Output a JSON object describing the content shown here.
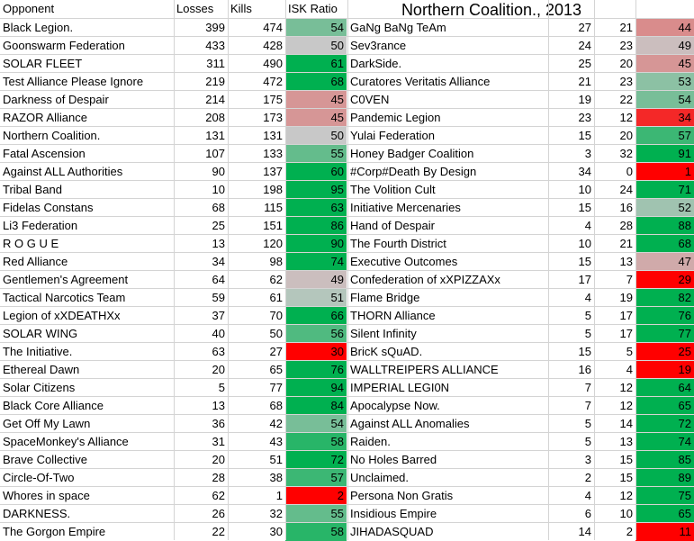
{
  "chart_data": {
    "type": "table",
    "title": "Northern Coalition., 2013",
    "columns": [
      "Opponent",
      "Losses",
      "Kills",
      "ISK Ratio"
    ],
    "left_rows": [
      [
        "Black Legion.",
        399,
        474,
        54
      ],
      [
        "Goonswarm Federation",
        433,
        428,
        50
      ],
      [
        "SOLAR FLEET",
        311,
        490,
        61
      ],
      [
        "Test Alliance Please Ignore",
        219,
        472,
        68
      ],
      [
        "Darkness of Despair",
        214,
        175,
        45
      ],
      [
        "RAZOR Alliance",
        208,
        173,
        45
      ],
      [
        "Northern Coalition.",
        131,
        131,
        50
      ],
      [
        "Fatal Ascension",
        107,
        133,
        55
      ],
      [
        "Against ALL Authorities",
        90,
        137,
        60
      ],
      [
        "Tribal Band",
        10,
        198,
        95
      ],
      [
        "Fidelas Constans",
        68,
        115,
        63
      ],
      [
        "Li3 Federation",
        25,
        151,
        86
      ],
      [
        "R O G U E",
        13,
        120,
        90
      ],
      [
        "Red Alliance",
        34,
        98,
        74
      ],
      [
        "Gentlemen's Agreement",
        64,
        62,
        49
      ],
      [
        "Tactical Narcotics Team",
        59,
        61,
        51
      ],
      [
        "Legion of xXDEATHXx",
        37,
        70,
        66
      ],
      [
        "SOLAR WING",
        40,
        50,
        56
      ],
      [
        "The Initiative.",
        63,
        27,
        30
      ],
      [
        "Ethereal Dawn",
        20,
        65,
        76
      ],
      [
        "Solar Citizens",
        5,
        77,
        94
      ],
      [
        "Black Core Alliance",
        13,
        68,
        84
      ],
      [
        "Get Off My Lawn",
        36,
        42,
        54
      ],
      [
        "SpaceMonkey's Alliance",
        31,
        43,
        58
      ],
      [
        "Brave Collective",
        20,
        51,
        72
      ],
      [
        "Circle-Of-Two",
        28,
        38,
        57
      ],
      [
        "Whores in space",
        62,
        1,
        2
      ],
      [
        "DARKNESS.",
        26,
        32,
        55
      ],
      [
        "The Gorgon Empire",
        22,
        30,
        58
      ]
    ],
    "right_rows": [
      [
        "GaNg BaNg TeAm",
        27,
        21,
        44
      ],
      [
        "Sev3rance",
        24,
        23,
        49
      ],
      [
        "DarkSide.",
        25,
        20,
        45
      ],
      [
        "Curatores Veritatis Alliance",
        21,
        23,
        53
      ],
      [
        "C0VEN",
        19,
        22,
        54
      ],
      [
        "Pandemic Legion",
        23,
        12,
        34
      ],
      [
        "Yulai Federation",
        15,
        20,
        57
      ],
      [
        "Honey Badger Coalition",
        3,
        32,
        91
      ],
      [
        "#Corp#Death By Design",
        34,
        0,
        1
      ],
      [
        "The Volition Cult",
        10,
        24,
        71
      ],
      [
        "Initiative Mercenaries",
        15,
        16,
        52
      ],
      [
        "Hand of Despair",
        4,
        28,
        88
      ],
      [
        "The Fourth District",
        10,
        21,
        68
      ],
      [
        "Executive Outcomes",
        15,
        13,
        47
      ],
      [
        "Confederation of xXPIZZAXx",
        17,
        7,
        29
      ],
      [
        "Flame Bridge",
        4,
        19,
        82
      ],
      [
        "THORN Alliance",
        5,
        17,
        76
      ],
      [
        "Silent Infinity",
        5,
        17,
        77
      ],
      [
        "BricK sQuAD.",
        15,
        5,
        25
      ],
      [
        "WALLTREIPERS ALLIANCE",
        16,
        4,
        19
      ],
      [
        "IMPERIAL LEGI0N",
        7,
        12,
        64
      ],
      [
        "Apocalypse Now.",
        7,
        12,
        65
      ],
      [
        "Against ALL Anomalies",
        5,
        14,
        72
      ],
      [
        "Raiden.",
        5,
        13,
        74
      ],
      [
        "No Holes Barred",
        3,
        15,
        85
      ],
      [
        "Unclaimed.",
        2,
        15,
        89
      ],
      [
        "Persona Non Gratis",
        4,
        12,
        75
      ],
      [
        "Insidious Empire",
        6,
        10,
        65
      ],
      [
        "JIHADASQUAD",
        14,
        2,
        11
      ]
    ],
    "color_scale": {
      "low": "#ff0000",
      "mid": "#c8c8c8",
      "high": "#00b050"
    }
  }
}
